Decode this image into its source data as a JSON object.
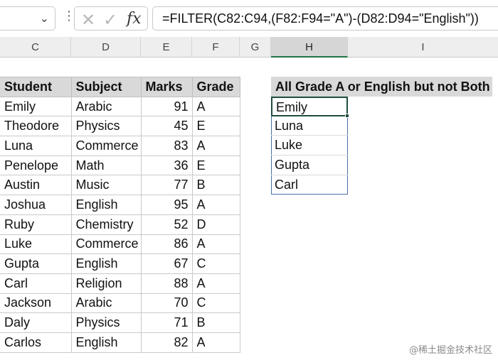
{
  "name_box": {
    "chevron_icon": "chevron-down-icon"
  },
  "formula_bar": {
    "cancel_icon": "✕",
    "confirm_icon": "✓",
    "fx_label": "fx",
    "formula": "=FILTER(C82:C94,(F82:F94=\"A\")-(D82:D94=\"English\"))"
  },
  "columns": [
    {
      "letter": "C",
      "selected": false
    },
    {
      "letter": "D",
      "selected": false
    },
    {
      "letter": "E",
      "selected": false
    },
    {
      "letter": "F",
      "selected": false
    },
    {
      "letter": "G",
      "selected": false
    },
    {
      "letter": "H",
      "selected": true
    },
    {
      "letter": "I",
      "selected": false
    }
  ],
  "table": {
    "headers": [
      "Student",
      "Subject",
      "Marks",
      "Grade"
    ],
    "rows": [
      [
        "Emily",
        "Arabic",
        "91",
        "A"
      ],
      [
        "Theodore",
        "Physics",
        "45",
        "E"
      ],
      [
        "Luna",
        "Commerce",
        "83",
        "A"
      ],
      [
        "Penelope",
        "Math",
        "36",
        "E"
      ],
      [
        "Austin",
        "Music",
        "77",
        "B"
      ],
      [
        "Joshua",
        "English",
        "95",
        "A"
      ],
      [
        "Ruby",
        "Chemistry",
        "52",
        "D"
      ],
      [
        "Luke",
        "Commerce",
        "86",
        "A"
      ],
      [
        "Gupta",
        "English",
        "67",
        "C"
      ],
      [
        "Carl",
        "Religion",
        "88",
        "A"
      ],
      [
        "Jackson",
        "Arabic",
        "70",
        "C"
      ],
      [
        "Daly",
        "Physics",
        "71",
        "B"
      ],
      [
        "Carlos",
        "English",
        "82",
        "A"
      ]
    ]
  },
  "result": {
    "header": "All Grade A  or English but not Both",
    "values": [
      "Emily",
      "Luna",
      "Luke",
      "Gupta",
      "Carl"
    ]
  },
  "watermark": "@稀土掘金技术社区",
  "colors": {
    "selection_green": "#1f4e3d",
    "header_gray": "#d9d9d9",
    "spill_border": "#4a6fa5"
  }
}
